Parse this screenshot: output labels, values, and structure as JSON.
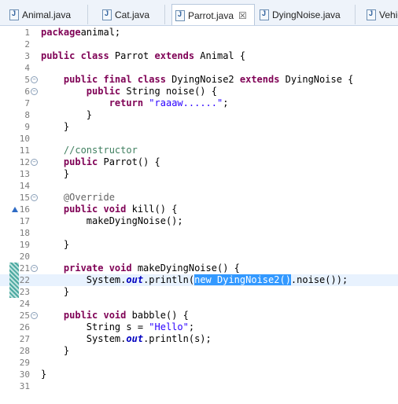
{
  "tabs": [
    {
      "label": "Animal.java",
      "active": false
    },
    {
      "label": "Cat.java",
      "active": false
    },
    {
      "label": "Parrot.java",
      "active": true
    },
    {
      "label": "DyingNoise.java",
      "active": false
    },
    {
      "label": "Vehic",
      "active": false
    }
  ],
  "close_glyph": "☒",
  "colors": {
    "keyword": "#7f0055",
    "string": "#2a00ff",
    "comment": "#3f7f5f",
    "selection": "#3399ff"
  },
  "lines": [
    {
      "n": "1",
      "parts": [
        [
          "kw",
          "package"
        ],
        [
          "",
          "animal;"
        ]
      ]
    },
    {
      "n": "2",
      "parts": []
    },
    {
      "n": "3",
      "parts": [
        [
          "kw",
          "public class"
        ],
        [
          "",
          " Parrot "
        ],
        [
          "kw",
          "extends"
        ],
        [
          "",
          " Animal {"
        ]
      ]
    },
    {
      "n": "4",
      "parts": []
    },
    {
      "n": "5",
      "fold": true,
      "parts": [
        [
          "",
          "    "
        ],
        [
          "kw",
          "public final class"
        ],
        [
          "",
          " DyingNoise2 "
        ],
        [
          "kw",
          "extends"
        ],
        [
          "",
          " DyingNoise {"
        ]
      ]
    },
    {
      "n": "6",
      "fold": true,
      "parts": [
        [
          "",
          "        "
        ],
        [
          "kw",
          "public"
        ],
        [
          "",
          " String noise() {"
        ]
      ]
    },
    {
      "n": "7",
      "parts": [
        [
          "",
          "            "
        ],
        [
          "kw",
          "return"
        ],
        [
          "",
          " "
        ],
        [
          "str",
          "\"raaaw......\""
        ],
        [
          "",
          ";"
        ]
      ]
    },
    {
      "n": "8",
      "parts": [
        [
          "",
          "        }"
        ]
      ]
    },
    {
      "n": "9",
      "parts": [
        [
          "",
          "    }"
        ]
      ]
    },
    {
      "n": "10",
      "parts": []
    },
    {
      "n": "11",
      "parts": [
        [
          "",
          "    "
        ],
        [
          "cm",
          "//constructor"
        ]
      ]
    },
    {
      "n": "12",
      "fold": true,
      "parts": [
        [
          "",
          "    "
        ],
        [
          "kw",
          "public"
        ],
        [
          "",
          " Parrot() {"
        ]
      ]
    },
    {
      "n": "13",
      "parts": [
        [
          "",
          "    }"
        ]
      ]
    },
    {
      "n": "14",
      "parts": []
    },
    {
      "n": "15",
      "fold": true,
      "parts": [
        [
          "",
          "    "
        ],
        [
          "ann",
          "@Override"
        ]
      ]
    },
    {
      "n": "16",
      "override": true,
      "parts": [
        [
          "",
          "    "
        ],
        [
          "kw",
          "public void"
        ],
        [
          "",
          " kill() {"
        ]
      ]
    },
    {
      "n": "17",
      "parts": [
        [
          "",
          "        makeDyingNoise();"
        ]
      ]
    },
    {
      "n": "18",
      "parts": []
    },
    {
      "n": "19",
      "parts": [
        [
          "",
          "    }"
        ]
      ]
    },
    {
      "n": "20",
      "parts": []
    },
    {
      "n": "21",
      "fold": true,
      "parts": [
        [
          "",
          "    "
        ],
        [
          "kw",
          "private void"
        ],
        [
          "",
          " makeDyingNoise() {"
        ]
      ]
    },
    {
      "n": "22",
      "current": true,
      "parts": [
        [
          "",
          "        System."
        ],
        [
          "fld",
          "out"
        ],
        [
          "",
          ".println("
        ],
        [
          "sel",
          "new DyingNoise2()"
        ],
        [
          "",
          ".noise());"
        ]
      ]
    },
    {
      "n": "23",
      "parts": [
        [
          "",
          "    }"
        ]
      ]
    },
    {
      "n": "24",
      "parts": []
    },
    {
      "n": "25",
      "fold": true,
      "parts": [
        [
          "",
          "    "
        ],
        [
          "kw",
          "public void"
        ],
        [
          "",
          " babble() {"
        ]
      ]
    },
    {
      "n": "26",
      "parts": [
        [
          "",
          "        String s = "
        ],
        [
          "str",
          "\"Hello\""
        ],
        [
          "",
          ";"
        ]
      ]
    },
    {
      "n": "27",
      "parts": [
        [
          "",
          "        System."
        ],
        [
          "fld",
          "out"
        ],
        [
          "",
          ".println(s);"
        ]
      ]
    },
    {
      "n": "28",
      "parts": [
        [
          "",
          "    }"
        ]
      ]
    },
    {
      "n": "29",
      "parts": []
    },
    {
      "n": "30",
      "parts": [
        [
          "",
          "}"
        ]
      ]
    },
    {
      "n": "31",
      "parts": []
    }
  ]
}
